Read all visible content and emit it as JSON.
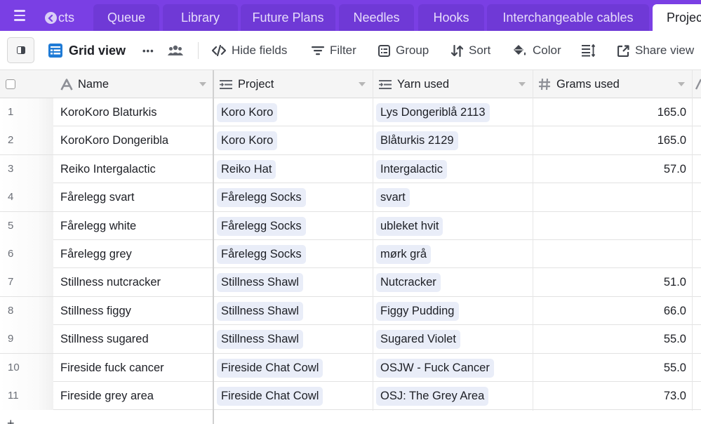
{
  "tabs": [
    {
      "label": "Projects",
      "state": "scrolled-partial"
    },
    {
      "label": "Queue"
    },
    {
      "label": "Library"
    },
    {
      "label": "Future Plans"
    },
    {
      "label": "Needles"
    },
    {
      "label": "Hooks"
    },
    {
      "label": "Interchangeable cables"
    },
    {
      "label": "Projects",
      "state": "active"
    }
  ],
  "tab_partial_text": "cts",
  "toolbar": {
    "view_name": "Grid view",
    "more_label": "•••",
    "hide_fields": "Hide fields",
    "filter": "Filter",
    "group": "Group",
    "sort": "Sort",
    "color": "Color",
    "share_view": "Share view"
  },
  "columns": [
    {
      "label": "Name",
      "type": "text"
    },
    {
      "label": "Project",
      "type": "link"
    },
    {
      "label": "Yarn used",
      "type": "link"
    },
    {
      "label": "Grams used",
      "type": "number"
    }
  ],
  "rows": [
    {
      "num": "1",
      "name": "KoroKoro Blaturkis",
      "project": "Koro Koro",
      "yarn": "Lys Dongeriblå 2113",
      "grams": "165.0"
    },
    {
      "num": "2",
      "name": "KoroKoro Dongeribla",
      "project": "Koro Koro",
      "yarn": "Blåturkis 2129",
      "grams": "165.0"
    },
    {
      "num": "3",
      "name": "Reiko Intergalactic",
      "project": "Reiko Hat",
      "yarn": "Intergalactic",
      "grams": "57.0"
    },
    {
      "num": "4",
      "name": "Fårelegg svart",
      "project": "Fårelegg Socks",
      "yarn": "svart",
      "grams": ""
    },
    {
      "num": "5",
      "name": "Fårelegg white",
      "project": "Fårelegg Socks",
      "yarn": "ubleket hvit",
      "grams": ""
    },
    {
      "num": "6",
      "name": "Fårelegg grey",
      "project": "Fårelegg Socks",
      "yarn": "mørk grå",
      "grams": ""
    },
    {
      "num": "7",
      "name": "Stillness nutcracker",
      "project": "Stillness Shawl",
      "yarn": "Nutcracker",
      "grams": "51.0"
    },
    {
      "num": "8",
      "name": "Stillness figgy",
      "project": "Stillness Shawl",
      "yarn": "Figgy Pudding",
      "grams": "66.0"
    },
    {
      "num": "9",
      "name": "Stillness sugared",
      "project": "Stillness Shawl",
      "yarn": "Sugared Violet",
      "grams": "55.0"
    },
    {
      "num": "10",
      "name": "Fireside fuck cancer",
      "project": "Fireside Chat Cowl",
      "yarn": "OSJW - Fuck Cancer",
      "grams": "55.0"
    },
    {
      "num": "11",
      "name": "Fireside grey area",
      "project": "Fireside Chat Cowl",
      "yarn": "OSJ: The Grey Area",
      "grams": "73.0"
    }
  ],
  "add_row_label": "+",
  "colors": {
    "tabbar": "#7a3fe4",
    "tab": "#6f39d6",
    "chip": "#e9edf8",
    "grid_view_icon": "#1f7bd6"
  }
}
